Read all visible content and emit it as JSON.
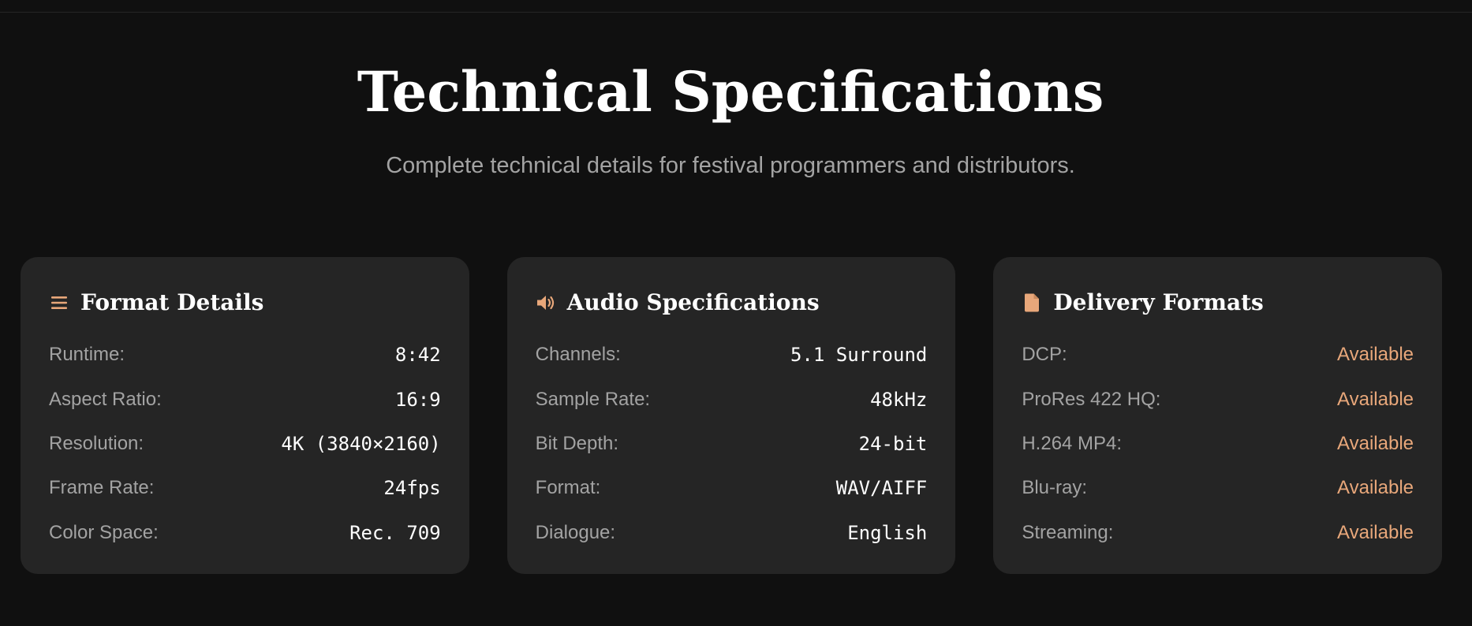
{
  "accent": "#e8a77a",
  "header": {
    "title": "Technical Specifications",
    "subtitle": "Complete technical details for festival programmers and distributors."
  },
  "cards": [
    {
      "title": "Format Details",
      "icon": "list-icon",
      "rows": [
        {
          "label": "Runtime:",
          "value": "8:42"
        },
        {
          "label": "Aspect Ratio:",
          "value": "16:9"
        },
        {
          "label": "Resolution:",
          "value": "4K (3840×2160)"
        },
        {
          "label": "Frame Rate:",
          "value": "24fps"
        },
        {
          "label": "Color Space:",
          "value": "Rec. 709"
        }
      ]
    },
    {
      "title": "Audio Specifications",
      "icon": "speaker-icon",
      "rows": [
        {
          "label": "Channels:",
          "value": "5.1 Surround"
        },
        {
          "label": "Sample Rate:",
          "value": "48kHz"
        },
        {
          "label": "Bit Depth:",
          "value": "24-bit"
        },
        {
          "label": "Format:",
          "value": "WAV/AIFF"
        },
        {
          "label": "Dialogue:",
          "value": "English"
        }
      ]
    },
    {
      "title": "Delivery Formats",
      "icon": "file-icon",
      "rows": [
        {
          "label": "DCP:",
          "value": "Available"
        },
        {
          "label": "ProRes 422 HQ:",
          "value": "Available"
        },
        {
          "label": "H.264 MP4:",
          "value": "Available"
        },
        {
          "label": "Blu-ray:",
          "value": "Available"
        },
        {
          "label": "Streaming:",
          "value": "Available"
        }
      ]
    }
  ]
}
